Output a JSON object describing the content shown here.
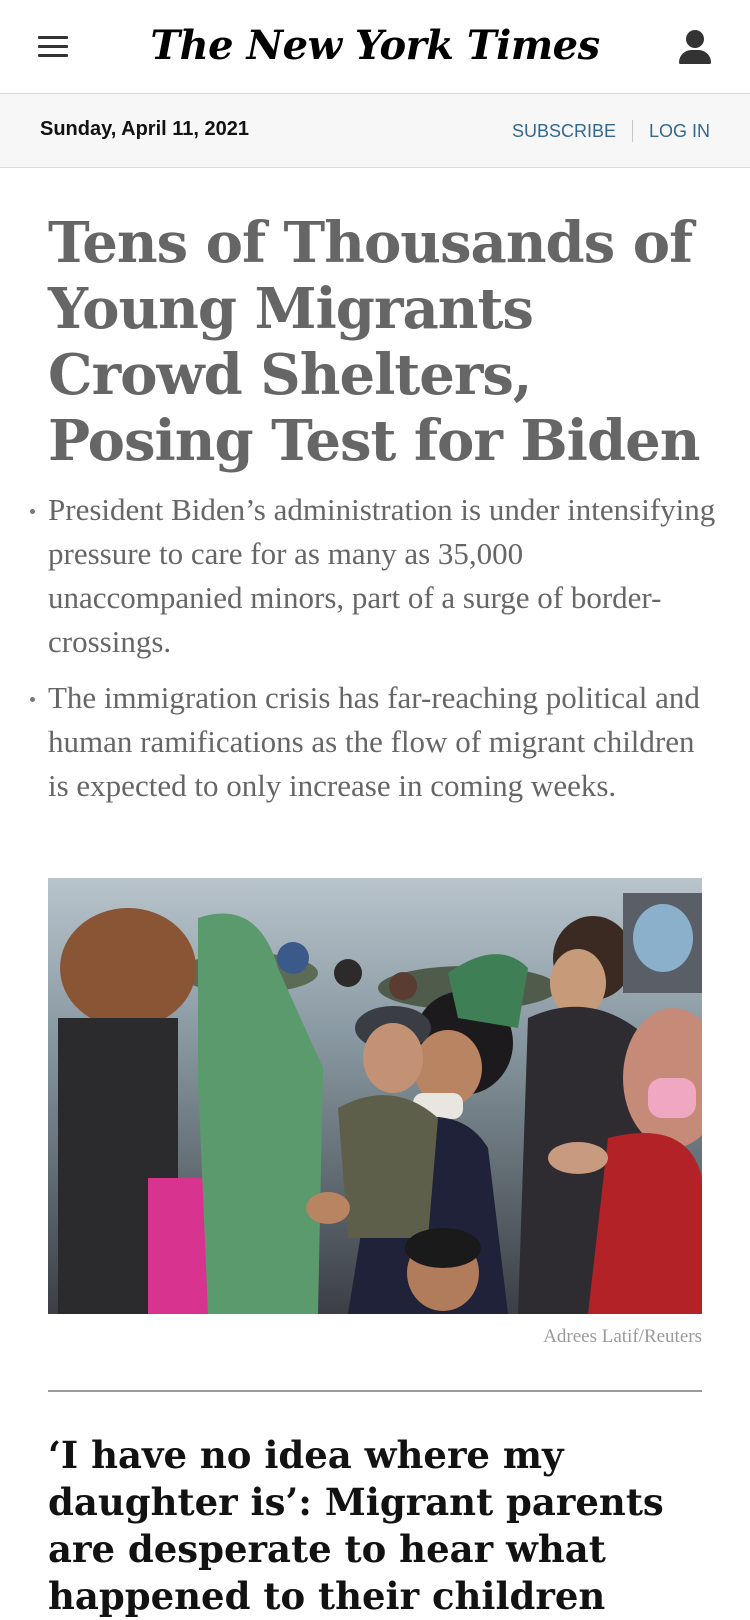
{
  "header": {
    "menu_icon": "hamburger-menu-icon",
    "logo_text": "The New York Times",
    "account_icon": "user-account-icon"
  },
  "datebar": {
    "date": "Sunday, April 11, 2021",
    "subscribe_label": "SUBSCRIBE",
    "login_label": "LOG IN"
  },
  "story": {
    "headline": "Tens of Thousands of Young Migrants Crowd Shelters, Posing Test for Biden",
    "summary": [
      "President Biden’s administration is under intensifying pressure to care for as many as 35,000 unaccompanied minors, part of a surge of border-crossings.",
      "The immigration crisis has far-reaching political and human ramifications as the flow of migrant children is expected to only increase in coming weeks."
    ],
    "photo_credit": "Adrees Latif/Reuters"
  },
  "next_story": {
    "headline": "‘I have no idea where my daughter is’: Migrant parents are desperate to hear what happened to their children"
  },
  "colors": {
    "link_blue": "#326891",
    "headline_gray": "#666666"
  }
}
